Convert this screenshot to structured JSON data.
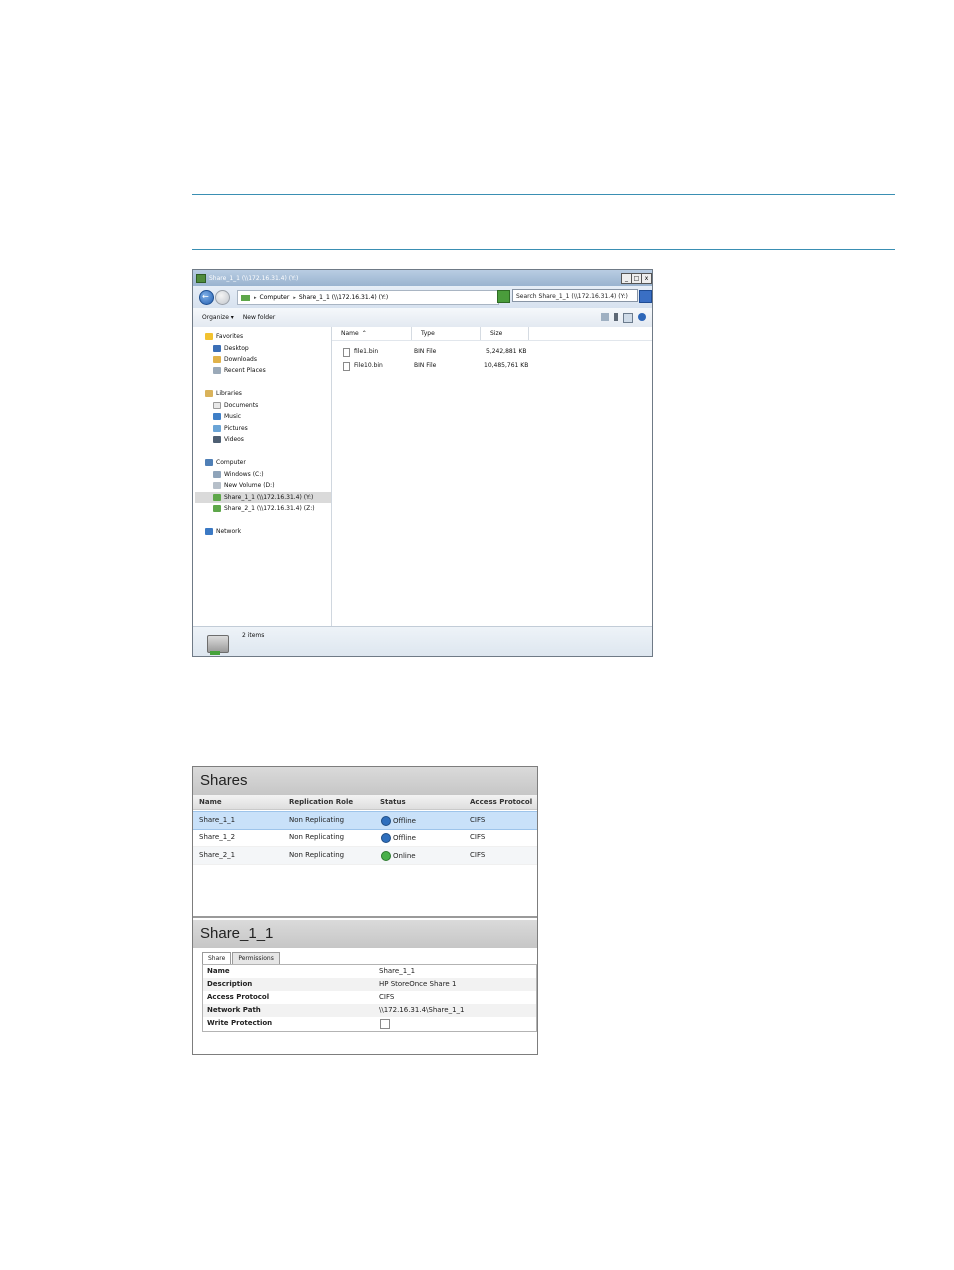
{
  "explorer": {
    "title": "Share_1_1 (\\\\172.16.31.4) (Y:)",
    "window_controls": [
      "_",
      "□",
      "x"
    ],
    "breadcrumbs": [
      "Computer",
      "Share_1_1 (\\\\172.16.31.4) (Y:)"
    ],
    "search_placeholder": "Search Share_1_1 (\\\\172.16.31.4) (Y:)",
    "toolbar": {
      "organize": "Organize ▾",
      "new_folder": "New folder"
    },
    "nav": {
      "favorites": "Favorites",
      "desktop": "Desktop",
      "downloads": "Downloads",
      "recent": "Recent Places",
      "libraries": "Libraries",
      "documents": "Documents",
      "music": "Music",
      "pictures": "Pictures",
      "videos": "Videos",
      "computer": "Computer",
      "windows_c": "Windows (C:)",
      "new_volume_d": "New Volume (D:)",
      "share_1_1": "Share_1_1 (\\\\172.16.31.4) (Y:)",
      "share_2_1": "Share_2_1 (\\\\172.16.31.4) (Z:)",
      "network": "Network"
    },
    "columns": {
      "name": "Name",
      "type": "Type",
      "size": "Size"
    },
    "files": [
      {
        "name": "file1.bin",
        "type": "BIN File",
        "size": "5,242,881 KB"
      },
      {
        "name": "File10.bin",
        "type": "BIN File",
        "size": "10,485,761 KB"
      }
    ],
    "status": "2 items"
  },
  "shares": {
    "title": "Shares",
    "columns": {
      "name": "Name",
      "replication": "Replication Role",
      "status": "Status",
      "protocol": "Access Protocol"
    },
    "rows": [
      {
        "name": "Share_1_1",
        "replication": "Non Replicating",
        "status": "Offline",
        "protocol": "CIFS"
      },
      {
        "name": "Share_1_2",
        "replication": "Non Replicating",
        "status": "Offline",
        "protocol": "CIFS"
      },
      {
        "name": "Share_2_1",
        "replication": "Non Replicating",
        "status": "Online",
        "protocol": "CIFS"
      }
    ],
    "detail": {
      "title": "Share_1_1",
      "tabs": [
        "Share",
        "Permissions"
      ],
      "props": {
        "name_label": "Name",
        "name_value": "Share_1_1",
        "desc_label": "Description",
        "desc_value": "HP StoreOnce Share 1",
        "protocol_label": "Access Protocol",
        "protocol_value": "CIFS",
        "path_label": "Network Path",
        "path_value": "\\\\172.16.31.4\\Share_1_1",
        "write_label": "Write Protection"
      }
    }
  },
  "colors": {
    "rule": "#3a8fb3",
    "selection": "#c9e1f9",
    "offline": "#2f6fbd",
    "online": "#49b04a"
  }
}
